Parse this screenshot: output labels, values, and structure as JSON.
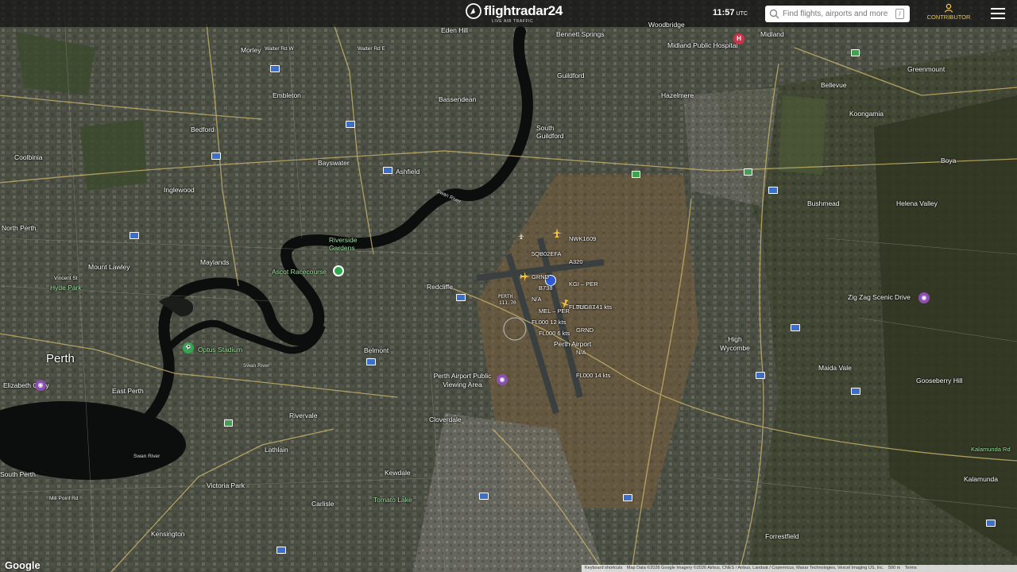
{
  "brand": {
    "name": "flightradar24",
    "tagline": "LIVE AIR TRAFFIC"
  },
  "clock": {
    "time": "11:57",
    "zone": "UTC"
  },
  "search": {
    "placeholder": "Find flights, airports and more",
    "shortcut": "/"
  },
  "contributor": {
    "label": "CONTRIBUTOR"
  },
  "colors": {
    "accent": "#f5c542",
    "poi_purple": "#8a4fb0",
    "poi_green": "#2fa84f"
  },
  "map": {
    "place_labels": [
      "Morley",
      "Walter Rd W",
      "Walter Rd E",
      "Eden Hill",
      "Bennett Springs",
      "Woodbridge",
      "Midland",
      "Midland Public Hospital",
      "Bayswater",
      "Bassendean",
      "Guildford",
      "Hazelmere",
      "Bellevue",
      "Greenmount",
      "Koongamia",
      "Embleton",
      "Bedford",
      "Coolbinia",
      "South Guildford",
      "Inglewood",
      "Ashfield",
      "Bushmead",
      "Helena Valley",
      "Boya",
      "North Perth",
      "Maylands",
      "Mount Lawley",
      "Riverside Gardens",
      "Ascot Racecourse",
      "Redcliffe",
      "Perth Airport",
      "Vincent St",
      "Hyde Park",
      "Perth",
      "Belmont",
      "High Wycombe",
      "Maida Vale",
      "Gooseberry Hill",
      "Zig Zag Scenic Drive",
      "Optus Stadium",
      "East Perth",
      "Elizabeth Quay",
      "Rivervale",
      "Perth Airport Public Viewing Area",
      "Cloverdale",
      "Lathlain",
      "Kewdale",
      "Victoria Park",
      "Carlisle",
      "Tomato Lake",
      "Kensington",
      "South Perth",
      "Mill Point Rd",
      "Forrestfield",
      "Kalamunda",
      "Kalamunda Rd",
      "Swan River",
      "PERTH"
    ],
    "airport_code_label": "111.70",
    "flights": [
      {
        "callsign": "NWK1609",
        "type": "A320",
        "route": "KGI – PER",
        "alt_speed": "FL000 ~ 141 kts"
      },
      {
        "callsign": "5QB02EFA",
        "type": "GRND",
        "route": "N/A",
        "alt_speed": "FL000 12 kts"
      },
      {
        "callsign": "B738",
        "type": "MEL – PER",
        "route": "",
        "alt_speed": "FL000 6 kts"
      },
      {
        "callsign": "TUG87",
        "type": "GRND",
        "route": "N/A",
        "alt_speed": "FL000 14 kts"
      }
    ]
  },
  "footer": {
    "google": "Google",
    "keyboard": "Keyboard shortcuts",
    "attribution": "Map Data ©2026 Google Imagery ©2026 Airbus, CNES / Airbus, Landsat / Copernicus, Maxar Technologies, Vexcel Imaging US, Inc.",
    "scale": "500 m",
    "terms": "Terms"
  }
}
